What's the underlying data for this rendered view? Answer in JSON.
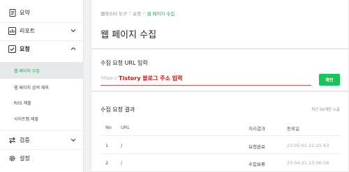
{
  "sidebar": {
    "items": [
      {
        "label": "요약",
        "icon": "document-icon"
      },
      {
        "label": "리포트",
        "icon": "chart-icon",
        "chevron": "chevron-down-icon"
      },
      {
        "label": "요청",
        "icon": "checkbox-icon",
        "chevron": "chevron-up-icon"
      },
      {
        "label": "검증",
        "icon": "transfer-icon",
        "chevron": "chevron-down-icon"
      },
      {
        "label": "설정",
        "icon": "gear-icon"
      }
    ],
    "sub_items": [
      {
        "label": "웹 페이지 수집",
        "active": true
      },
      {
        "label": "웹 페이지 검색 제외",
        "active": false
      },
      {
        "label": "RSS 제출",
        "active": false
      },
      {
        "label": "사이트맵 제출",
        "active": false
      }
    ]
  },
  "breadcrumb": {
    "root": "웹마스터 도구",
    "section": "요청",
    "current": "웹 페이지 수집"
  },
  "page_title": "웹 페이지 수집",
  "form": {
    "title": "수집 요청 URL 입력",
    "prefix": "https://",
    "value": "Tistory 블로그 주소 입력",
    "button": "확인"
  },
  "results": {
    "title": "수집 요청 결과",
    "note": "최근 50개만 노출",
    "headers": {
      "no": "No",
      "url": "URL",
      "status": "처리결과",
      "date": "등록일"
    },
    "rows": [
      {
        "no": "1",
        "url": "/",
        "status": "요청완료",
        "date": "23.05.01 22:25:43"
      },
      {
        "no": "2",
        "url": "/",
        "status": "수집보류",
        "date": "23.04.21 13:06:58"
      }
    ]
  },
  "colors": {
    "accent": "#19c45d",
    "active_text": "#0fb45a",
    "input_text": "#d01010",
    "input_underline": "#e05050"
  }
}
